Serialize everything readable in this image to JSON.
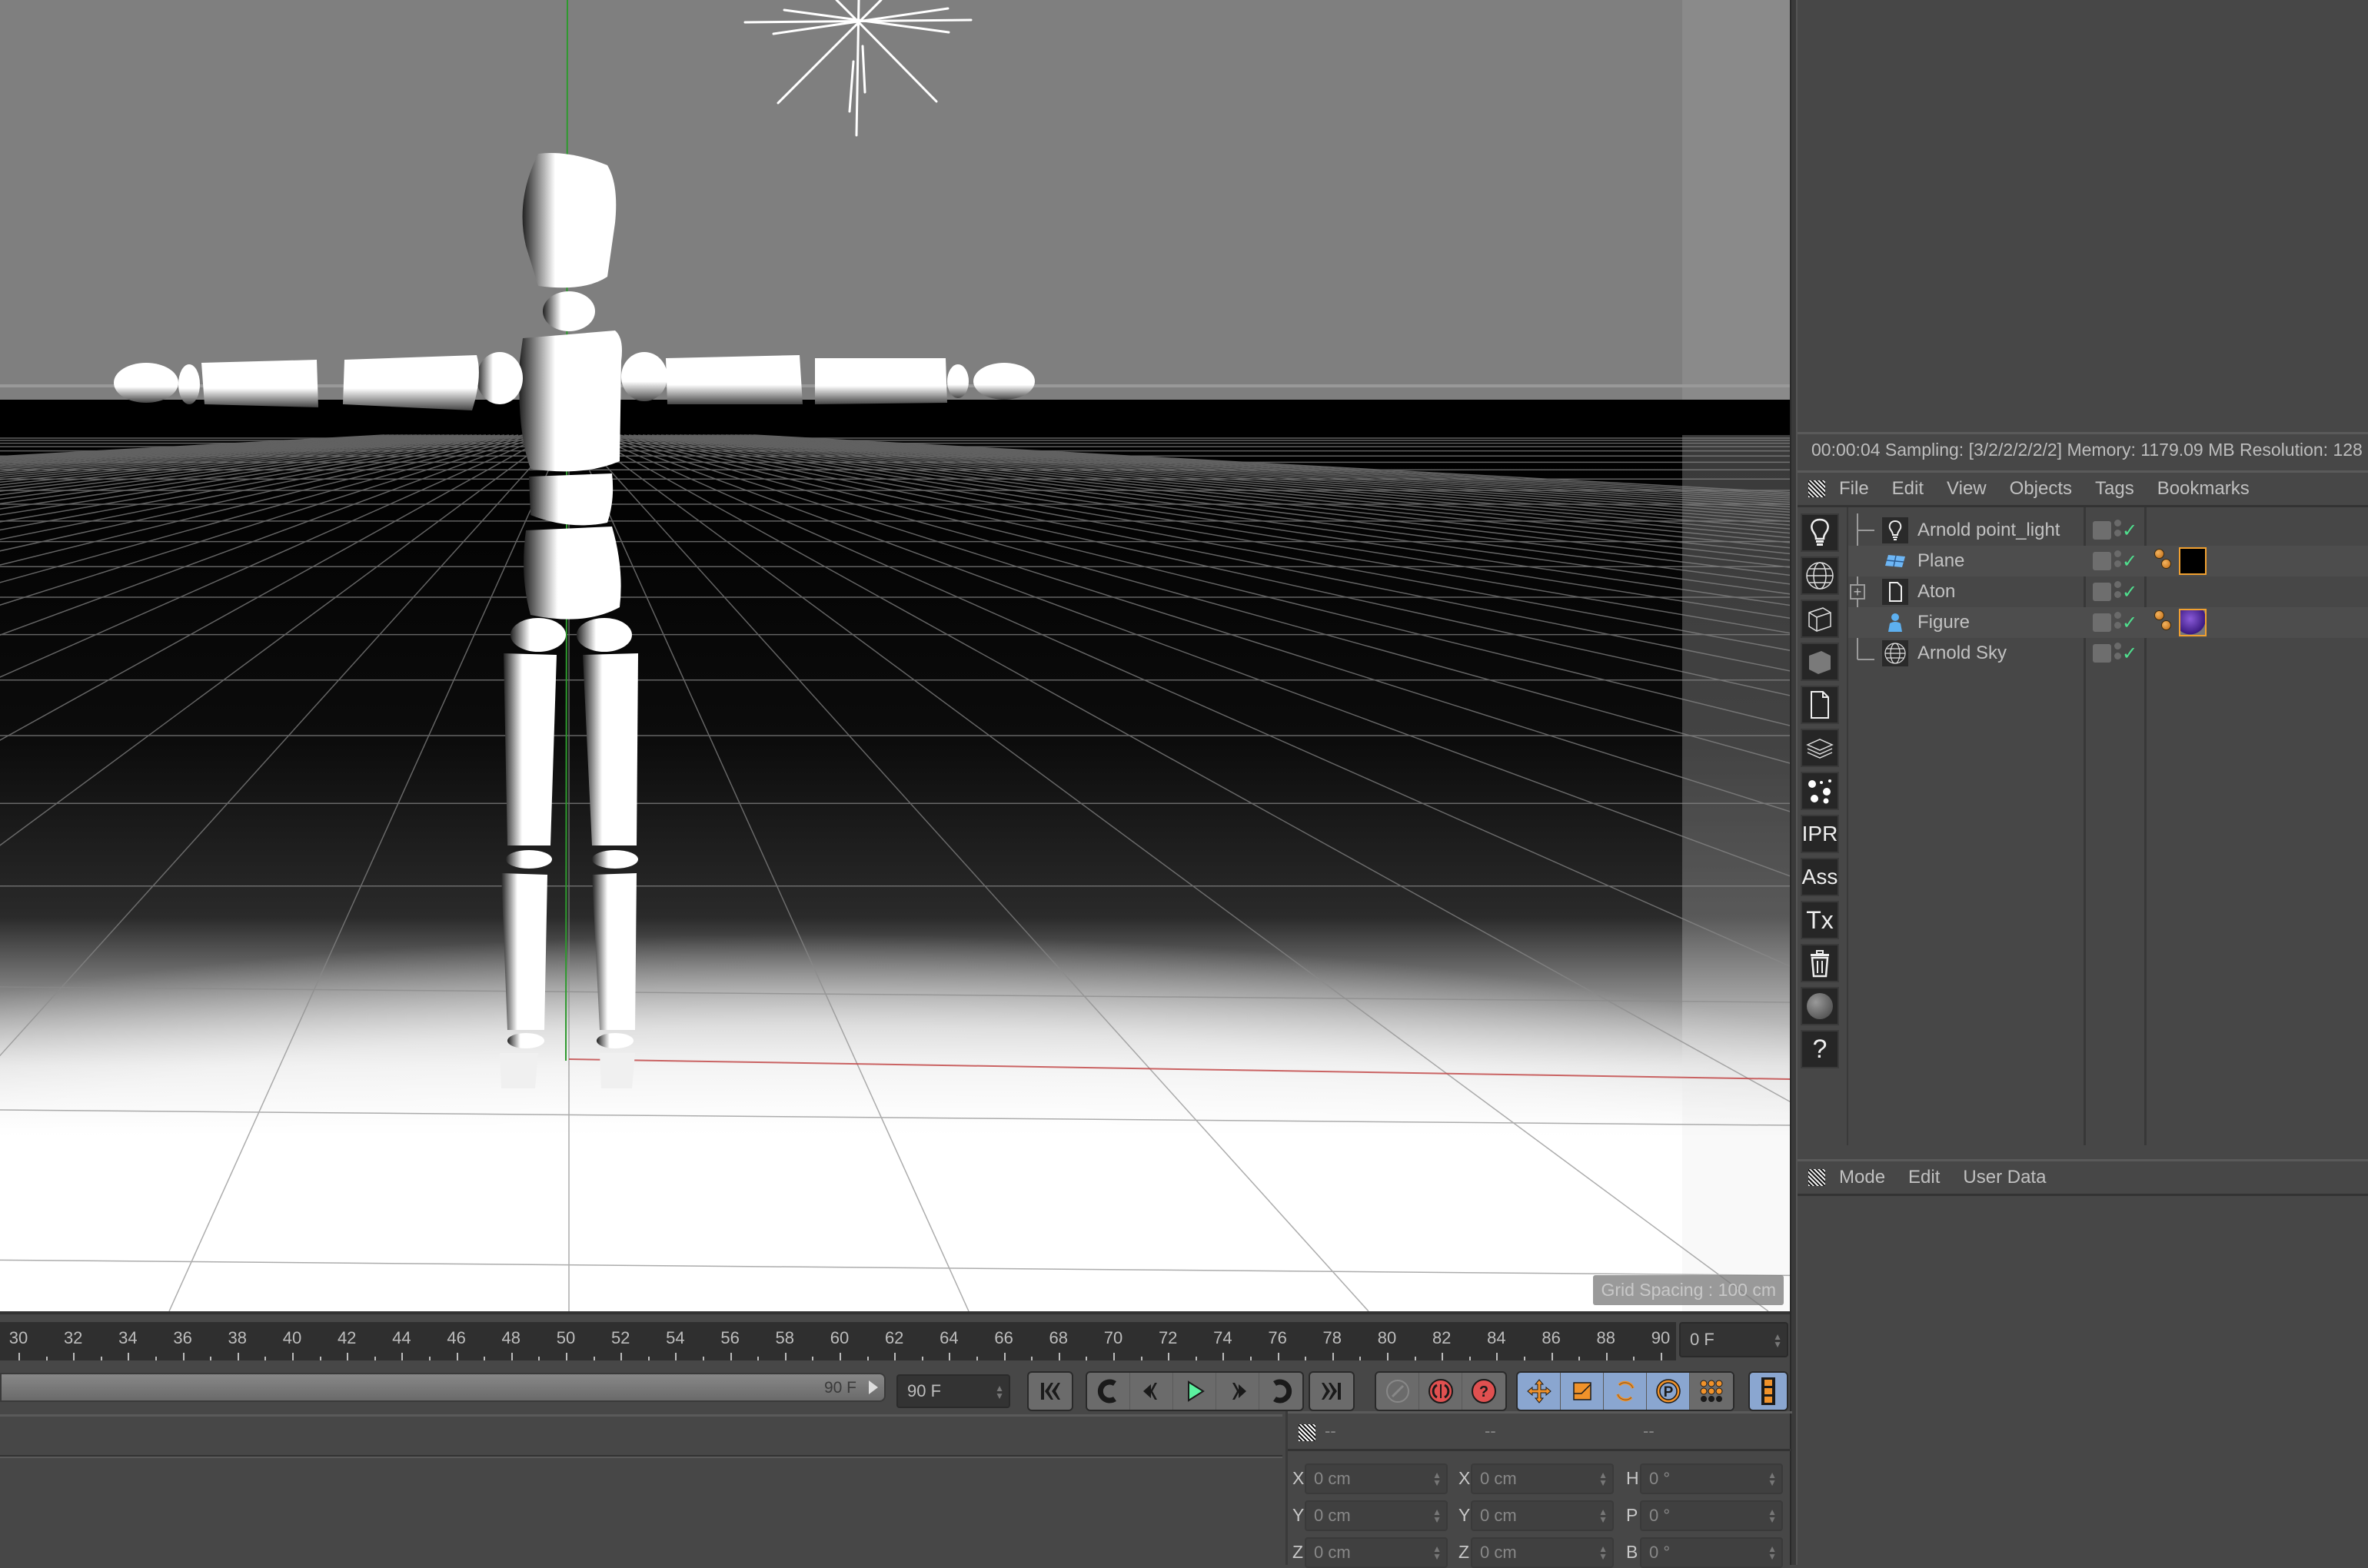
{
  "viewport": {
    "grid_spacing_label": "Grid Spacing : 100 cm",
    "scene": {
      "background_color": "#7f7f7f",
      "floor_dark_color": "#0a0a0a",
      "floor_light_color": "#ffffff",
      "y_axis_color": "#2e9a2e",
      "x_axis_color": "#c04040"
    }
  },
  "render_status": {
    "text": "00:00:04  Sampling: [3/2/2/2/2/2]  Memory: 1179.09 MB  Resolution: 128"
  },
  "object_manager": {
    "menu": [
      "File",
      "Edit",
      "View",
      "Objects",
      "Tags",
      "Bookmarks"
    ],
    "tools": [
      {
        "name": "light-icon",
        "glyph": "💡"
      },
      {
        "name": "sky-globe-icon",
        "glyph": "◍"
      },
      {
        "name": "wire-cube-icon",
        "glyph": "⬡"
      },
      {
        "name": "solid-cube-icon",
        "glyph": "■"
      },
      {
        "name": "document-icon",
        "glyph": "🗋"
      },
      {
        "name": "layers-icon",
        "glyph": "≋"
      },
      {
        "name": "dots-icon",
        "glyph": "⁘"
      },
      {
        "name": "ipr-icon",
        "glyph": "IPR"
      },
      {
        "name": "ass-icon",
        "glyph": "Ass"
      },
      {
        "name": "tx-icon",
        "glyph": "Tx"
      },
      {
        "name": "trash-icon",
        "glyph": "🗑"
      },
      {
        "name": "sphere-icon",
        "glyph": "●"
      },
      {
        "name": "help-icon",
        "glyph": "?"
      }
    ],
    "objects": [
      {
        "name": "Arnold point_light",
        "icon": "light-bulb-icon",
        "expandable": false,
        "visible": true,
        "tags": []
      },
      {
        "name": "Plane",
        "icon": "plane-icon",
        "expandable": false,
        "visible": true,
        "tags": [
          "phong-tag",
          "material-black"
        ]
      },
      {
        "name": "Aton",
        "icon": "document-icon",
        "expandable": true,
        "visible": true,
        "tags": []
      },
      {
        "name": "Figure",
        "icon": "figure-icon",
        "expandable": false,
        "visible": true,
        "tags": [
          "phong-tag",
          "material-purple"
        ]
      },
      {
        "name": "Arnold Sky",
        "icon": "sky-globe-icon",
        "expandable": false,
        "visible": true,
        "tags": []
      }
    ],
    "material_colors": {
      "material-black": "#000000",
      "material-purple": "#5a2aa0"
    }
  },
  "attributes": {
    "menu": [
      "Mode",
      "Edit",
      "User Data"
    ]
  },
  "timeline": {
    "ruler_start": 30,
    "ruler_end": 90,
    "ruler_step": 2,
    "current_frame": "0 F",
    "scrub_end_label": "90 F",
    "end_frame": "90 F"
  },
  "playback": {
    "buttons": [
      "go-to-start",
      "previous-keyframe",
      "previous-frame",
      "play-forward",
      "next-frame",
      "next-keyframe",
      "go-to-end"
    ],
    "record_buttons": [
      "autokey",
      "record-active-objects",
      "keyframe-selection"
    ],
    "key_buttons": [
      "key-position",
      "key-scale",
      "key-rotation",
      "key-parameter",
      "key-point-level-animation"
    ],
    "accent_color": "#8aa6d0"
  },
  "coordinates": {
    "headers": [
      "--",
      "--",
      "--"
    ],
    "position": [
      {
        "axis": "X",
        "value": "0 cm"
      },
      {
        "axis": "Y",
        "value": "0 cm"
      },
      {
        "axis": "Z",
        "value": "0 cm"
      }
    ],
    "size": [
      {
        "axis": "X",
        "value": "0 cm"
      },
      {
        "axis": "Y",
        "value": "0 cm"
      },
      {
        "axis": "Z",
        "value": "0 cm"
      }
    ],
    "rotation": [
      {
        "axis": "H",
        "value": "0 °"
      },
      {
        "axis": "P",
        "value": "0 °"
      },
      {
        "axis": "B",
        "value": "0 °"
      }
    ]
  }
}
